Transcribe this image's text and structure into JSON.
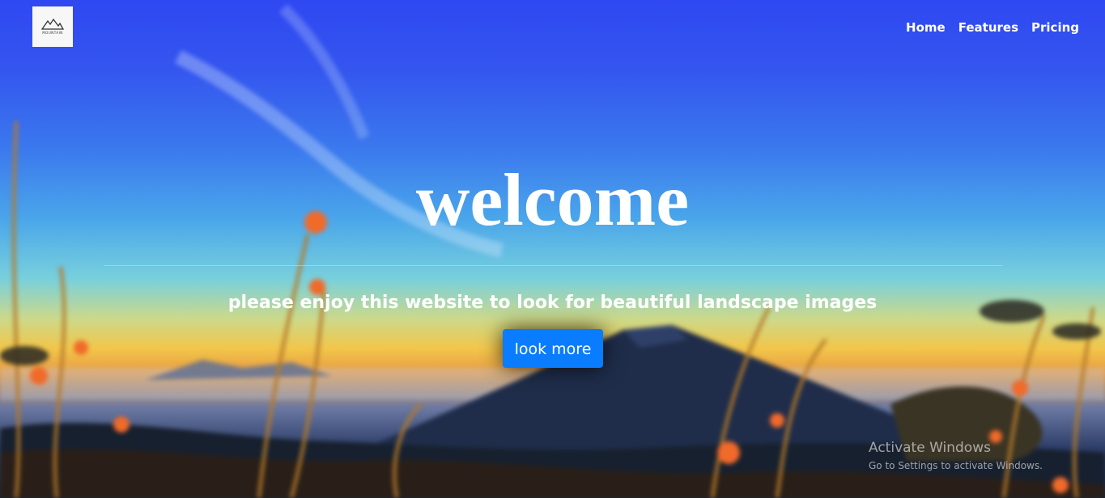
{
  "logo": {
    "text": "MOUNTAIN",
    "icon": "mountain-logo-icon"
  },
  "nav": {
    "items": [
      "Home",
      "Features",
      "Pricing"
    ]
  },
  "hero": {
    "headline": "welcome",
    "subline": "please enjoy this website to look for beautiful landscape images",
    "cta_label": "look more",
    "background": "landscape-photo-mountain-sunrise"
  },
  "watermark": {
    "title": "Activate Windows",
    "subtitle": "Go to Settings to activate Windows."
  },
  "colors": {
    "cta": "#0a7cff",
    "text": "#ffffff"
  }
}
